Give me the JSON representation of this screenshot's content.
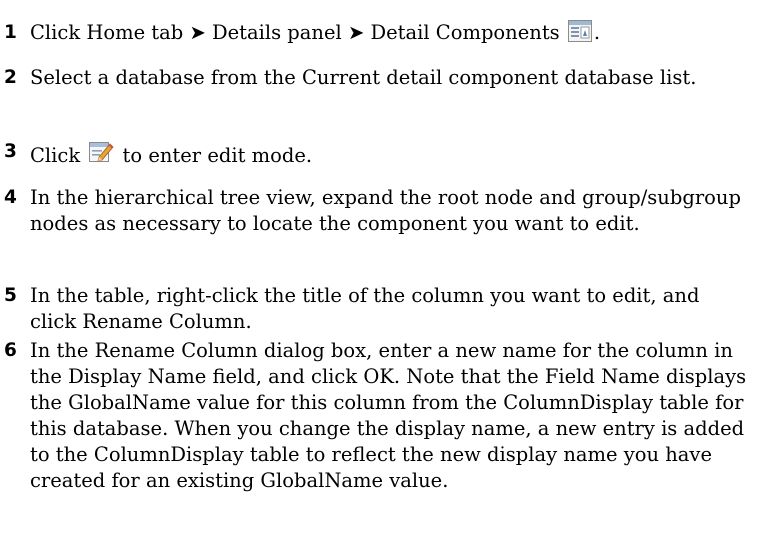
{
  "steps": [
    {
      "num": "1",
      "pre": "Click Home tab ➤ Details panel ➤ Detail Components",
      "icon": "detail-components-icon",
      "post": "."
    },
    {
      "num": "2",
      "text": "Select a database from the Current detail component database list."
    },
    {
      "num": "3",
      "pre": "Click",
      "icon": "edit-mode-icon",
      "post": "to enter edit mode."
    },
    {
      "num": "4",
      "text": "In the hierarchical tree view, expand the root node and group/subgroup nodes as necessary to locate the component you want to edit."
    },
    {
      "num": "5",
      "text": "In the table, right-click the title of the column you want to edit, and click Rename Column."
    },
    {
      "num": "6",
      "text": "In the Rename Column dialog box, enter a new name for the column in the Display Name field, and click OK. Note that the Field Name displays the GlobalName value for this column from the ColumnDisplay table for this database. When you change the display name, a new entry is added to the ColumnDisplay table to reflect the new display name you have created for an existing GlobalName value."
    }
  ]
}
